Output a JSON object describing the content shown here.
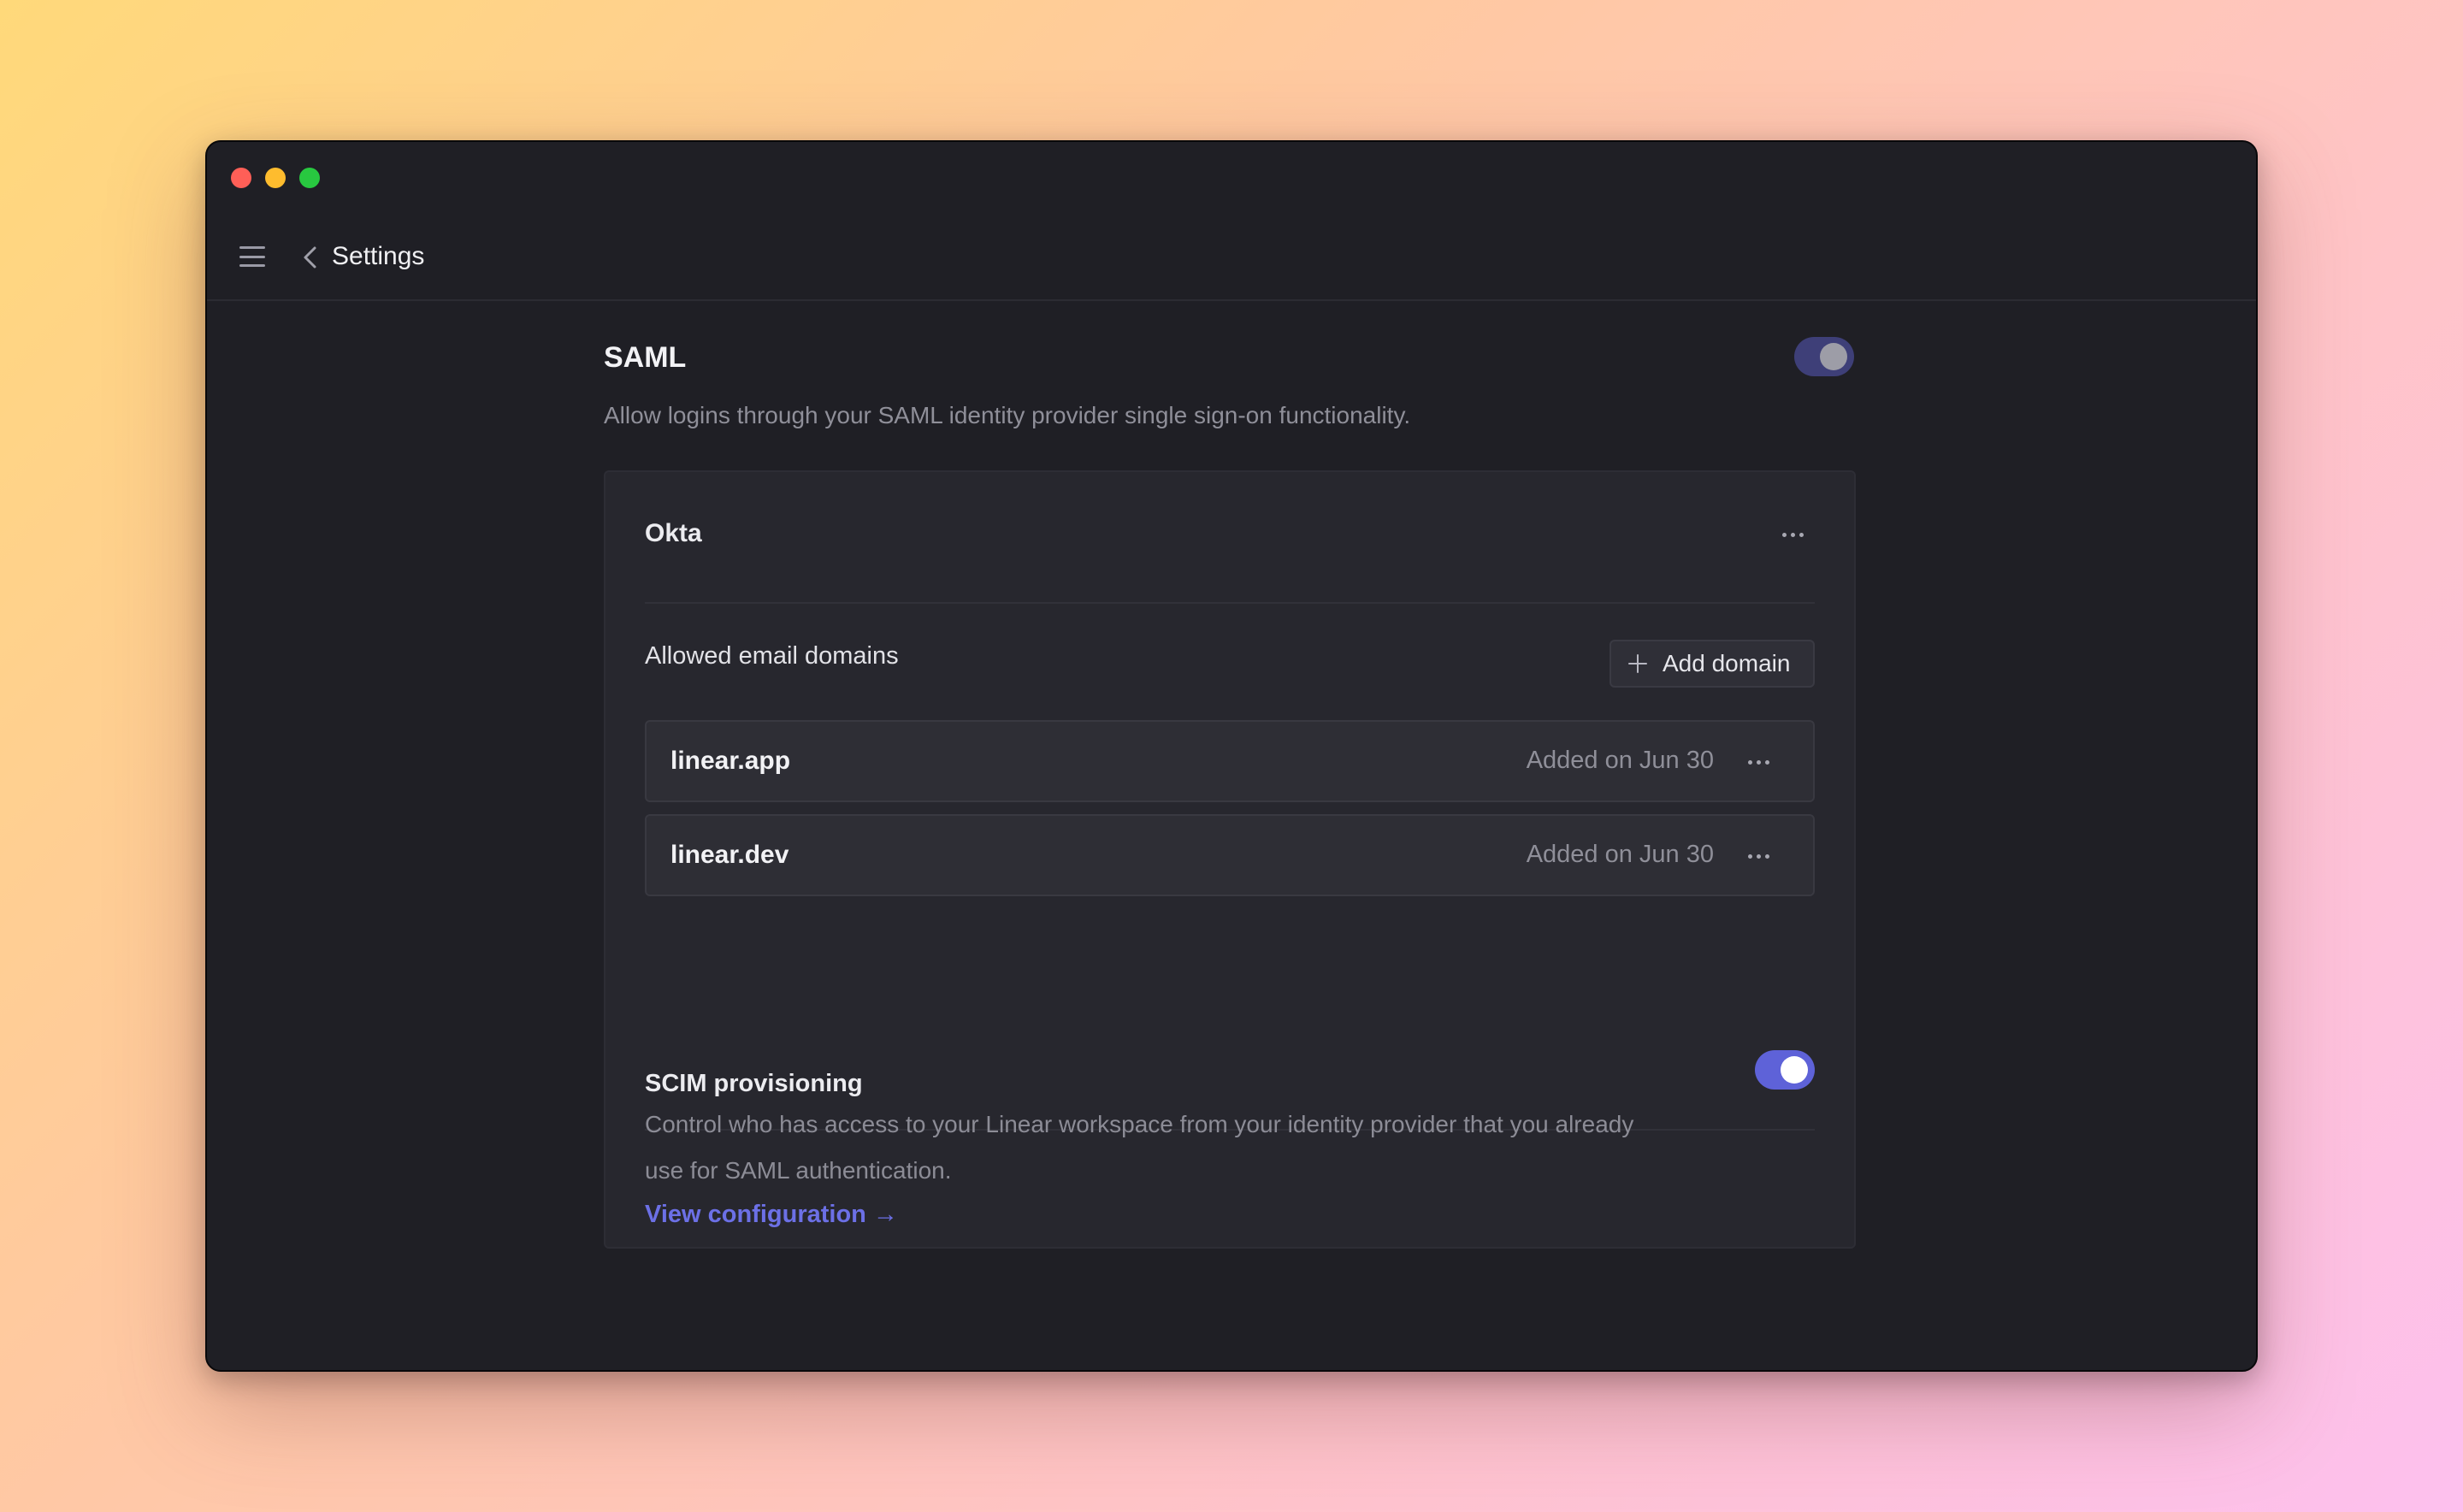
{
  "window": {
    "title": "Settings"
  },
  "saml": {
    "title": "SAML",
    "description": "Allow logins through your SAML identity provider single sign-on functionality.",
    "enabled": true
  },
  "provider": {
    "name": "Okta",
    "domains_label": "Allowed email domains",
    "add_domain_label": "Add domain",
    "domains": [
      {
        "name": "linear.app",
        "added": "Added on Jun 30"
      },
      {
        "name": "linear.dev",
        "added": "Added on Jun 30"
      }
    ]
  },
  "scim": {
    "title": "SCIM provisioning",
    "description": "Control who has access to your Linear workspace from your identity provider that you already use for SAML authentication.",
    "link_label": "View configuration →",
    "enabled": true
  },
  "colors": {
    "accent": "#5e62d8",
    "link": "#6c70e6"
  }
}
